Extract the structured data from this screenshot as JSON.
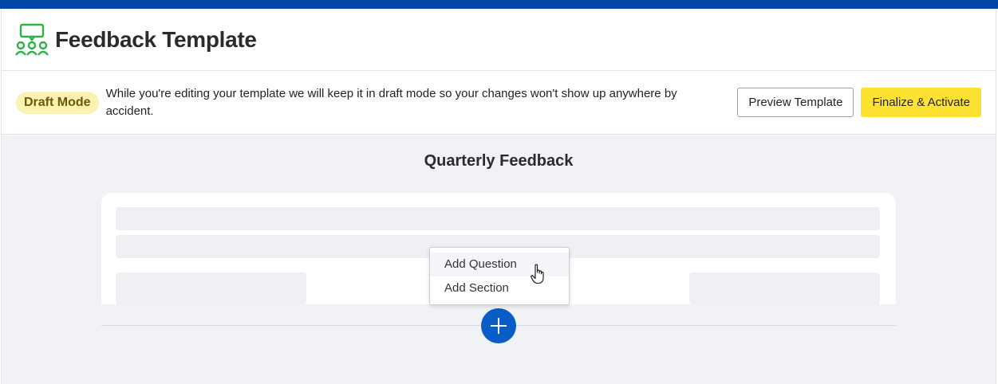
{
  "header": {
    "title": "Feedback Template",
    "logo_icon": "feedback-people-icon",
    "logo_color": "#2eb24a"
  },
  "draft": {
    "badge": "Draft Mode",
    "message": "While you're editing your template we will keep it in draft mode so your changes won't show up anywhere by accident.",
    "preview_label": "Preview Template",
    "finalize_label": "Finalize & Activate"
  },
  "form": {
    "title": "Quarterly Feedback"
  },
  "add_menu": {
    "items": [
      {
        "label": "Add Question"
      },
      {
        "label": "Add Section"
      }
    ],
    "button_icon": "plus-icon"
  },
  "colors": {
    "topbar": "#0046a8",
    "accent_blue": "#0a5cc7",
    "finalize_yellow": "#fde232",
    "badge_bg": "#fcf2b3"
  }
}
